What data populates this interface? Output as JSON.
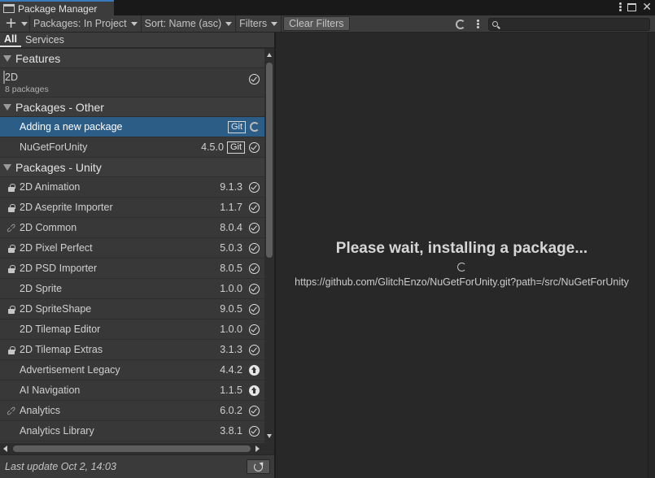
{
  "window": {
    "title": "Package Manager"
  },
  "toolbar": {
    "add_label": "+",
    "packages_dropdown": "Packages: In Project",
    "sort_dropdown": "Sort: Name (asc)",
    "filters_dropdown": "Filters",
    "clear_filters": "Clear Filters",
    "search": {
      "value": "",
      "placeholder": ""
    }
  },
  "subtabs": [
    {
      "label": "All",
      "active": true
    },
    {
      "label": "Services",
      "active": false
    }
  ],
  "groups": {
    "features": {
      "label": "Features",
      "items": [
        {
          "name": "2D",
          "subtitle": "8 packages",
          "status": "installed"
        }
      ]
    },
    "other": {
      "label": "Packages - Other",
      "items": [
        {
          "name": "Adding a new package",
          "version": "",
          "badge": "Git",
          "status": "loading",
          "selected": true
        },
        {
          "name": "NuGetForUnity",
          "version": "4.5.0",
          "badge": "Git",
          "status": "installed"
        }
      ]
    },
    "unity": {
      "label": "Packages - Unity",
      "items": [
        {
          "name": "2D Animation",
          "version": "9.1.3",
          "icon": "lock",
          "status": "installed"
        },
        {
          "name": "2D Aseprite Importer",
          "version": "1.1.7",
          "icon": "lock",
          "status": "installed"
        },
        {
          "name": "2D Common",
          "version": "8.0.4",
          "icon": "link",
          "status": "installed"
        },
        {
          "name": "2D Pixel Perfect",
          "version": "5.0.3",
          "icon": "lock",
          "status": "installed"
        },
        {
          "name": "2D PSD Importer",
          "version": "8.0.5",
          "icon": "lock",
          "status": "installed"
        },
        {
          "name": "2D Sprite",
          "version": "1.0.0",
          "icon": "",
          "status": "installed"
        },
        {
          "name": "2D SpriteShape",
          "version": "9.0.5",
          "icon": "lock",
          "status": "installed"
        },
        {
          "name": "2D Tilemap Editor",
          "version": "1.0.0",
          "icon": "",
          "status": "installed"
        },
        {
          "name": "2D Tilemap Extras",
          "version": "3.1.3",
          "icon": "lock",
          "status": "installed"
        },
        {
          "name": "Advertisement Legacy",
          "version": "4.4.2",
          "icon": "",
          "status": "update"
        },
        {
          "name": "AI Navigation",
          "version": "1.1.5",
          "icon": "",
          "status": "update"
        },
        {
          "name": "Analytics",
          "version": "6.0.2",
          "icon": "link",
          "status": "installed"
        },
        {
          "name": "Analytics Library",
          "version": "3.8.1",
          "icon": "",
          "status": "installed"
        }
      ]
    }
  },
  "footer": {
    "last_update": "Last update Oct 2, 14:03"
  },
  "detail": {
    "title": "Please wait, installing a package...",
    "url": "https://github.com/GlitchEnzo/NuGetForUnity.git?path=/src/NuGetForUnity"
  },
  "colors": {
    "selection": "#2c5d87",
    "accent": "#3a79bb",
    "background": "#282828",
    "list_background": "#383838"
  }
}
